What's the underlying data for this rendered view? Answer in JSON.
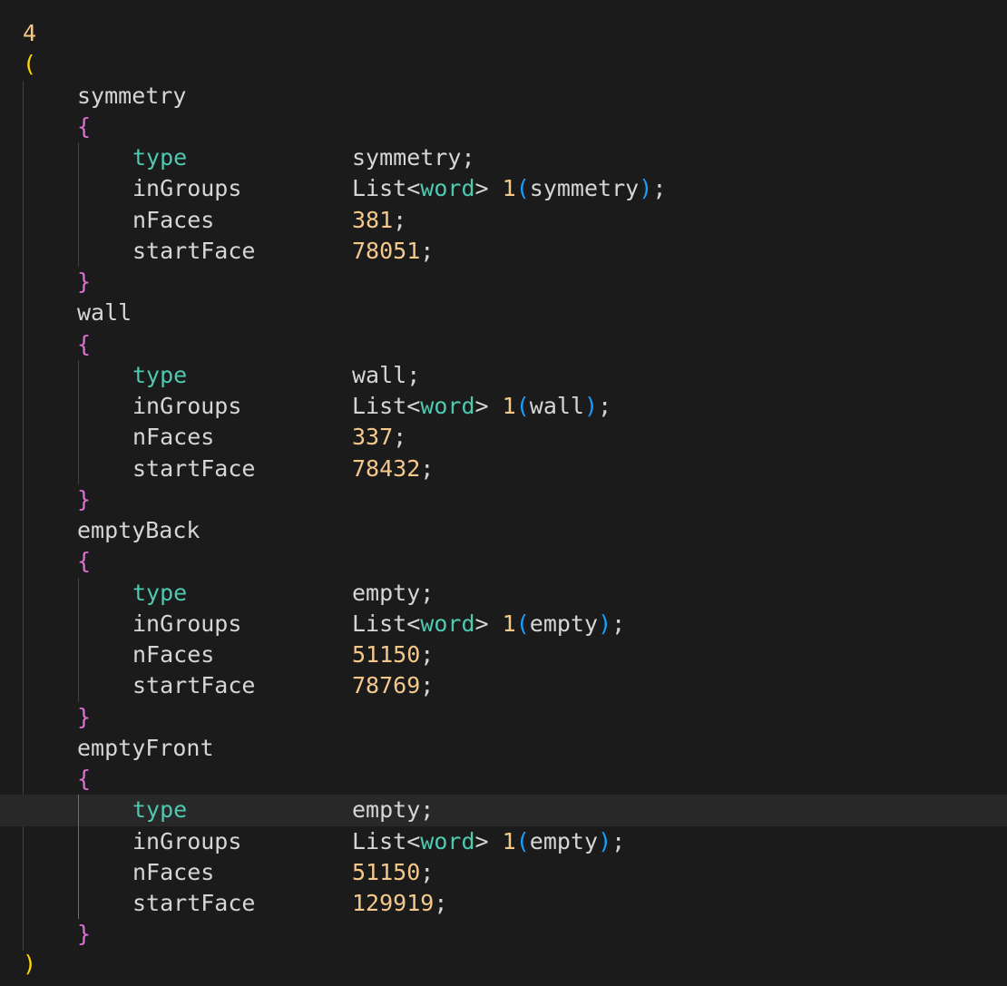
{
  "editor": {
    "count": "4",
    "open_paren": "(",
    "close_paren": ")",
    "open_brace": "{",
    "close_brace": "}",
    "semicolon": ";",
    "list_prefix": "List<",
    "list_word": "word",
    "list_suffix": "> 1",
    "group_open": "(",
    "group_close": ")",
    "keys": {
      "type": "type",
      "inGroups": "inGroups",
      "nFaces": "nFaces",
      "startFace": "startFace"
    },
    "patches": [
      {
        "name": "symmetry",
        "type": "symmetry",
        "group": "symmetry",
        "nFaces": "381",
        "startFace": "78051"
      },
      {
        "name": "wall",
        "type": "wall",
        "group": "wall",
        "nFaces": "337",
        "startFace": "78432"
      },
      {
        "name": "emptyBack",
        "type": "empty",
        "group": "empty",
        "nFaces": "51150",
        "startFace": "78769"
      },
      {
        "name": "emptyFront",
        "type": "empty",
        "group": "empty",
        "nFaces": "51150",
        "startFace": "129919"
      }
    ]
  }
}
